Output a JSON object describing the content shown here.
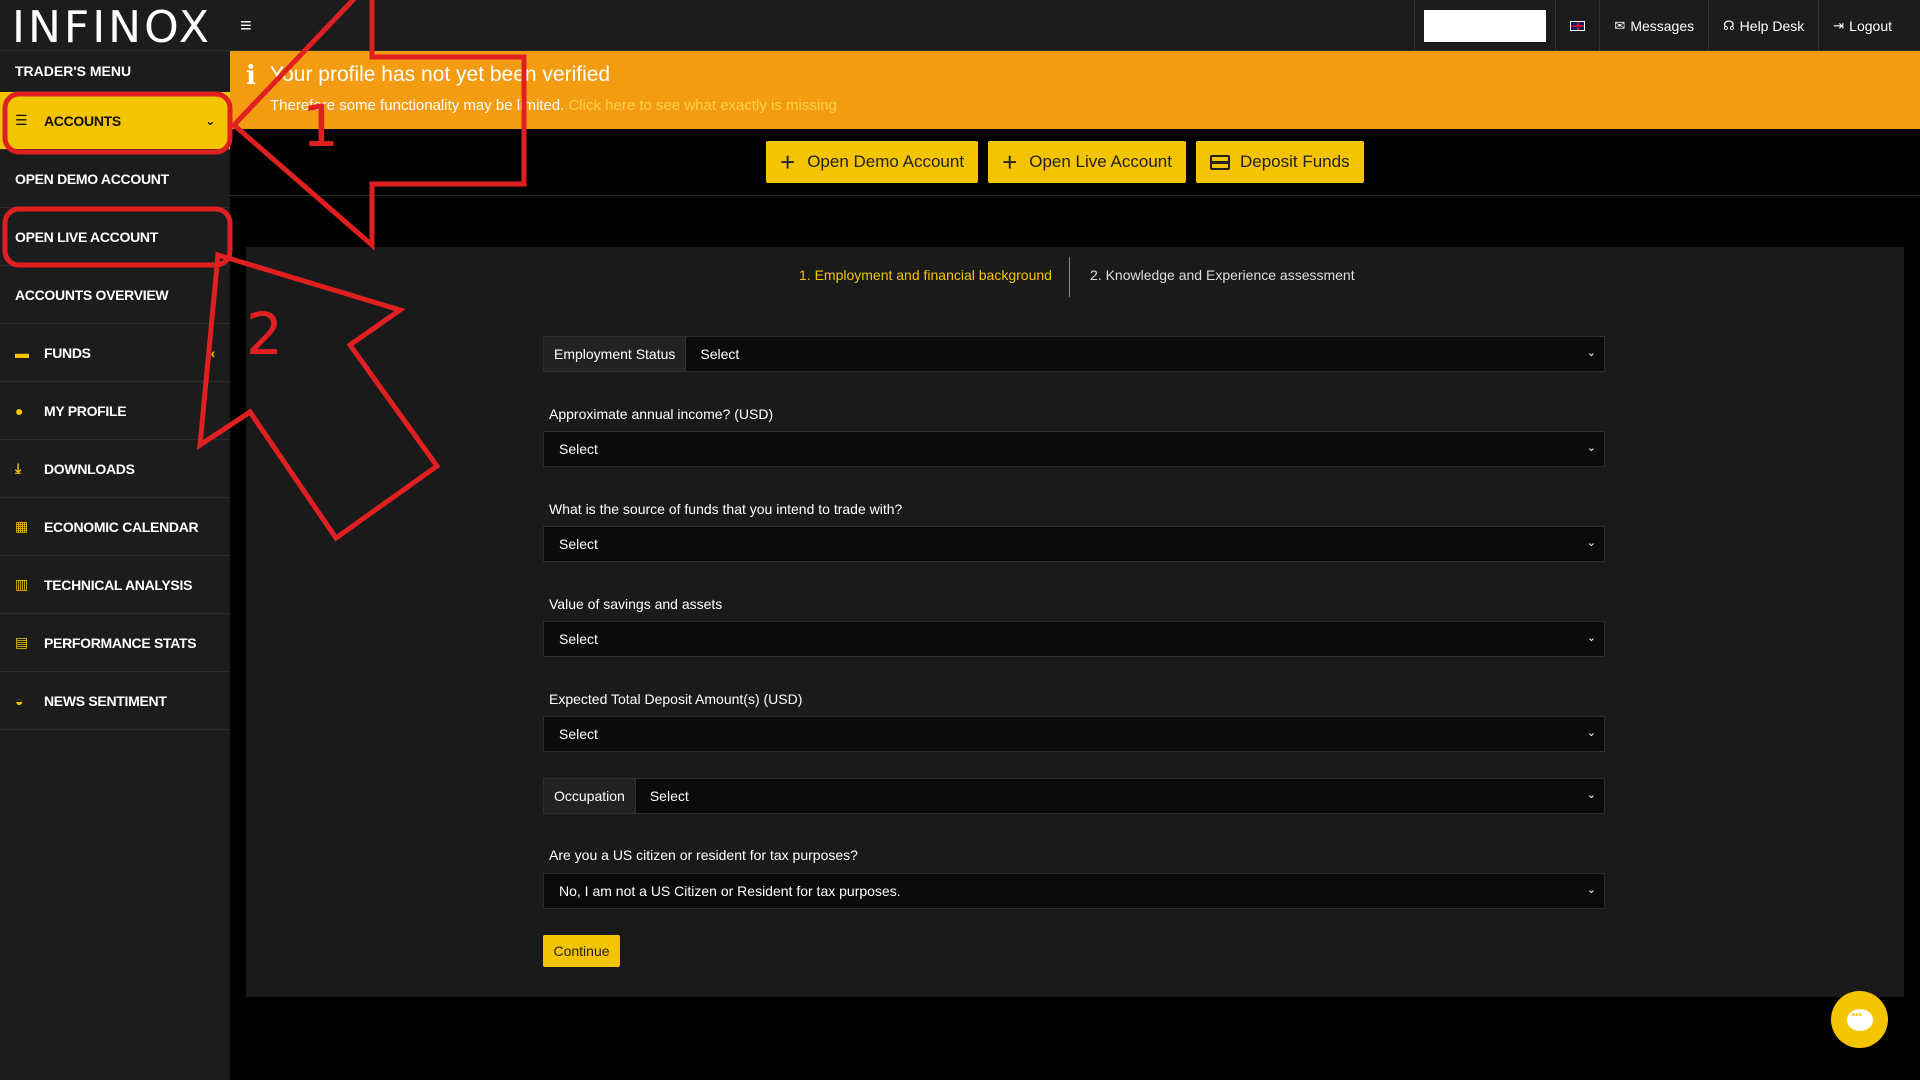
{
  "topbar": {
    "logo": "INFINOX",
    "menu_icon": "≡",
    "messages": "Messages",
    "help_desk": "Help Desk",
    "logout": "Logout",
    "search_value": ""
  },
  "sidebar": {
    "header": "TRADER'S MENU",
    "items": [
      {
        "label": "ACCOUNTS",
        "icon": "list-icon",
        "active": true
      },
      {
        "label": "OPEN DEMO ACCOUNT"
      },
      {
        "label": "OPEN LIVE ACCOUNT"
      },
      {
        "label": "ACCOUNTS OVERVIEW"
      },
      {
        "label": "FUNDS",
        "icon": "wallet-icon"
      },
      {
        "label": "MY PROFILE",
        "icon": "user-icon"
      },
      {
        "label": "DOWNLOADS",
        "icon": "download-icon"
      },
      {
        "label": "ECONOMIC CALENDAR",
        "icon": "calendar-icon"
      },
      {
        "label": "TECHNICAL ANALYSIS",
        "icon": "chart-icon"
      },
      {
        "label": "PERFORMANCE STATS",
        "icon": "card-icon"
      },
      {
        "label": "NEWS SENTIMENT",
        "icon": "gauge-icon"
      }
    ]
  },
  "banner": {
    "title": "Your profile has not yet been verified",
    "text": "Therefore some functionality may be limited.",
    "link": "Click here to see what exactly is missing"
  },
  "actions": {
    "demo": "Open Demo Account",
    "live": "Open Live Account",
    "deposit": "Deposit Funds"
  },
  "steps": {
    "step1": "1.  Employment and financial background",
    "step2": "2. Knowledge and Experience assessment"
  },
  "form": {
    "employment_status_label": "Employment Status",
    "employment_status_value": "Select",
    "income_label": "Approximate annual income? (USD)",
    "income_value": "Select",
    "source_label": "What is the source of funds that you intend to trade with?",
    "source_value": "Select",
    "savings_label": "Value of savings and assets",
    "savings_value": "Select",
    "deposit_label": "Expected Total Deposit Amount(s) (USD)",
    "deposit_value": "Select",
    "occupation_label": "Occupation",
    "occupation_value": "Select",
    "us_label": "Are you a US citizen or resident for tax purposes?",
    "us_value": "No, I am not a US Citizen or Resident for tax purposes.",
    "continue": "Continue"
  },
  "annotations": {
    "num1": "1",
    "num2": "2",
    "color": "#e02020"
  },
  "colors": {
    "accent": "#f5c400",
    "banner": "#f39c12",
    "sidebar": "#1c1c1c"
  }
}
